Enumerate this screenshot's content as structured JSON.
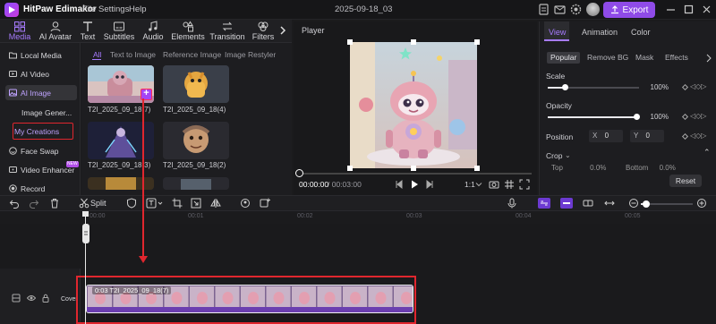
{
  "titlebar": {
    "app_title": "HitPaw Edimakor",
    "menu": [
      "File",
      "Settings",
      "Help"
    ],
    "project_name": "2025-09-18_03",
    "export_label": "Export"
  },
  "toolbar": {
    "tabs": [
      {
        "label": "Media",
        "icon": "media-icon"
      },
      {
        "label": "AI Avatar",
        "icon": "avatar-icon"
      },
      {
        "label": "Text",
        "icon": "text-icon"
      },
      {
        "label": "Subtitles",
        "icon": "subtitles-icon"
      },
      {
        "label": "Audio",
        "icon": "audio-icon"
      },
      {
        "label": "Elements",
        "icon": "elements-icon"
      },
      {
        "label": "Transition",
        "icon": "transition-icon"
      },
      {
        "label": "Filters",
        "icon": "filters-icon"
      }
    ]
  },
  "sidebar": {
    "items": [
      {
        "label": "Local Media"
      },
      {
        "label": "AI Video"
      },
      {
        "label": "AI Image"
      },
      {
        "label": "Image Gener..."
      },
      {
        "label": "My Creations"
      },
      {
        "label": "Face Swap"
      },
      {
        "label": "Video Enhancer"
      },
      {
        "label": "Record"
      }
    ],
    "new_badge": "NEW"
  },
  "media": {
    "subtabs": [
      "All",
      "Text to Image",
      "Reference Image",
      "Image Restyler"
    ],
    "items": [
      {
        "label": "T2I_2025_09_18(7)"
      },
      {
        "label": "T2I_2025_09_18(4)"
      },
      {
        "label": "T2I_2025_09_18(3)"
      },
      {
        "label": "T2I_2025_09_18(2)"
      }
    ]
  },
  "player": {
    "label": "Player",
    "time_current": "00:00:00",
    "time_total": "/ 00:03:00",
    "ratio": "1:1",
    "progress": 0
  },
  "properties": {
    "tabs": [
      "View",
      "Animation",
      "Color"
    ],
    "pills": [
      "Popular",
      "Remove BG",
      "Mask",
      "Effects"
    ],
    "scale_label": "Scale",
    "scale_value": "100%",
    "opacity_label": "Opacity",
    "opacity_value": "100%",
    "position_label": "Position",
    "pos_x_label": "X",
    "pos_x_value": "0",
    "pos_y_label": "Y",
    "pos_y_value": "0",
    "crop_label": "Crop",
    "crop_top_label": "Top",
    "crop_top_value": "0.0%",
    "crop_bottom_label": "Bottom",
    "crop_bottom_value": "0.0%",
    "reset_label": "Reset"
  },
  "timeline": {
    "split_label": "Split",
    "ticks": [
      "00:00",
      "00:01",
      "00:02",
      "00:03",
      "00:04",
      "00:05"
    ],
    "clip_label": "0:03  T2I_2025_09_18(7)",
    "cover_label": "Cover"
  },
  "colors": {
    "accent": "#a77bff",
    "export": "#8f4be8",
    "highlight_red": "#e0262e"
  }
}
